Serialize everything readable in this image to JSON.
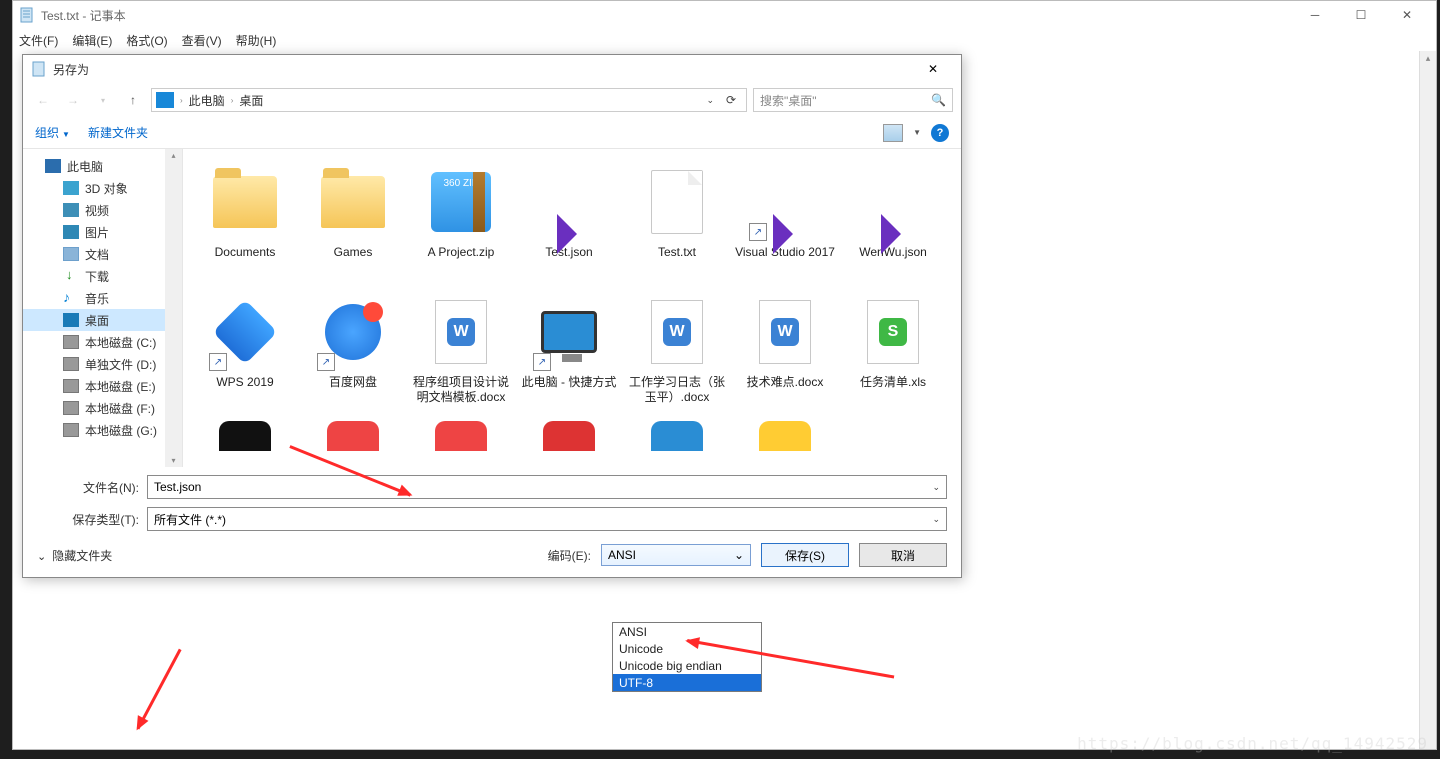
{
  "notepad": {
    "title": "Test.txt - 记事本",
    "menu": [
      "文件(F)",
      "编辑(E)",
      "格式(O)",
      "查看(V)",
      "帮助(H)"
    ]
  },
  "dialog": {
    "title": "另存为",
    "breadcrumbs": [
      "此电脑",
      "桌面"
    ],
    "searchPlaceholder": "搜索\"桌面\"",
    "toolbar": {
      "organize": "组织",
      "newfolder": "新建文件夹"
    },
    "tree": [
      {
        "label": "此电脑",
        "cls": "ic-pc",
        "sub": false,
        "sel": false
      },
      {
        "label": "3D 对象",
        "cls": "ic-3d",
        "sub": true,
        "sel": false
      },
      {
        "label": "视频",
        "cls": "ic-video",
        "sub": true,
        "sel": false
      },
      {
        "label": "图片",
        "cls": "ic-pic",
        "sub": true,
        "sel": false
      },
      {
        "label": "文档",
        "cls": "ic-doc",
        "sub": true,
        "sel": false
      },
      {
        "label": "下载",
        "cls": "ic-dl",
        "sub": true,
        "sel": false
      },
      {
        "label": "音乐",
        "cls": "ic-music",
        "sub": true,
        "sel": false,
        "glyph": "♪"
      },
      {
        "label": "桌面",
        "cls": "ic-desk",
        "sub": true,
        "sel": true
      },
      {
        "label": "本地磁盘 (C:)",
        "cls": "ic-disk",
        "sub": true,
        "sel": false
      },
      {
        "label": "单独文件 (D:)",
        "cls": "ic-disk",
        "sub": true,
        "sel": false
      },
      {
        "label": "本地磁盘 (E:)",
        "cls": "ic-disk",
        "sub": true,
        "sel": false
      },
      {
        "label": "本地磁盘 (F:)",
        "cls": "ic-disk",
        "sub": true,
        "sel": false
      },
      {
        "label": "本地磁盘 (G:)",
        "cls": "ic-disk",
        "sub": true,
        "sel": false
      }
    ],
    "files": [
      {
        "name": "Documents",
        "icon": "folder"
      },
      {
        "name": "Games",
        "icon": "folder"
      },
      {
        "name": "A Project.zip",
        "icon": "zip"
      },
      {
        "name": "Test.json",
        "icon": "vs"
      },
      {
        "name": "Test.txt",
        "icon": "txt"
      },
      {
        "name": "Visual Studio 2017",
        "icon": "vs",
        "shortcut": true
      },
      {
        "name": "WenWu.json",
        "icon": "vs"
      },
      {
        "name": "WPS 2019",
        "icon": "wps",
        "shortcut": true
      },
      {
        "name": "百度网盘",
        "icon": "baidu",
        "shortcut": true
      },
      {
        "name": "程序组项目设计说明文档模板.docx",
        "icon": "docx"
      },
      {
        "name": "此电脑 - 快捷方式",
        "icon": "monitor",
        "shortcut": true
      },
      {
        "name": "工作学习日志（张玉平）.docx",
        "icon": "docx"
      },
      {
        "name": "技术难点.docx",
        "icon": "docx"
      },
      {
        "name": "任务清单.xls",
        "icon": "xls"
      }
    ],
    "filenameLabel": "文件名(N):",
    "filenameValue": "Test.json",
    "saveTypeLabel": "保存类型(T):",
    "saveTypeValue": "所有文件  (*.*)",
    "hideFolders": "隐藏文件夹",
    "encodingLabel": "编码(E):",
    "encodingValue": "ANSI",
    "encodingOptions": [
      "ANSI",
      "Unicode",
      "Unicode big endian",
      "UTF-8"
    ],
    "encodingSelected": "UTF-8",
    "saveBtn": "保存(S)",
    "cancelBtn": "取消"
  },
  "watermark": "https://blog.csdn.net/qq_14942529",
  "partialColors": [
    "#111",
    "#e44",
    "#e44",
    "#d33",
    "#2a8dd4",
    "#fc3"
  ]
}
